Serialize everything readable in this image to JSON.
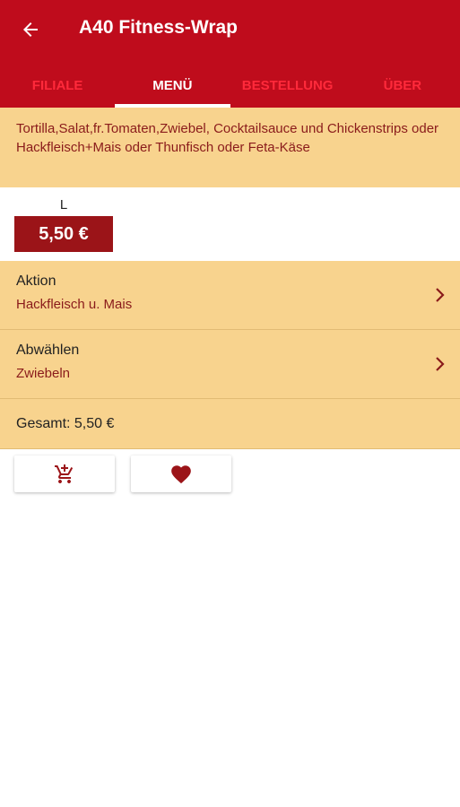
{
  "header": {
    "title": "A40 Fitness-Wrap",
    "back_icon": "arrow-left-icon"
  },
  "tabs": [
    {
      "label": "FILIALE",
      "active": false
    },
    {
      "label": "MENÜ",
      "active": true
    },
    {
      "label": "BESTELLUNG",
      "active": false
    },
    {
      "label": "ÜBER",
      "active": false
    }
  ],
  "product": {
    "description": "Tortilla,Salat,fr.Tomaten,Zwiebel, Cocktailsauce und Chickenstrips oder Hackfleisch+Mais oder Thunfisch oder Feta-Käse",
    "size_label": "L",
    "price": "5,50 €"
  },
  "options": [
    {
      "title": "Aktion",
      "value": "Hackfleisch u. Mais"
    },
    {
      "title": "Abwählen",
      "value": "Zwiebeln"
    }
  ],
  "total": "Gesamt: 5,50 €",
  "actions": {
    "cart_icon": "add-to-cart-icon",
    "favorite_icon": "heart-icon"
  },
  "colors": {
    "brand_red": "#bf0c1c",
    "tab_inactive": "#ff2a3b",
    "panel_yellow": "#f8d38e",
    "price_red": "#9b1418",
    "text_dark_red": "#8a1b1b"
  }
}
